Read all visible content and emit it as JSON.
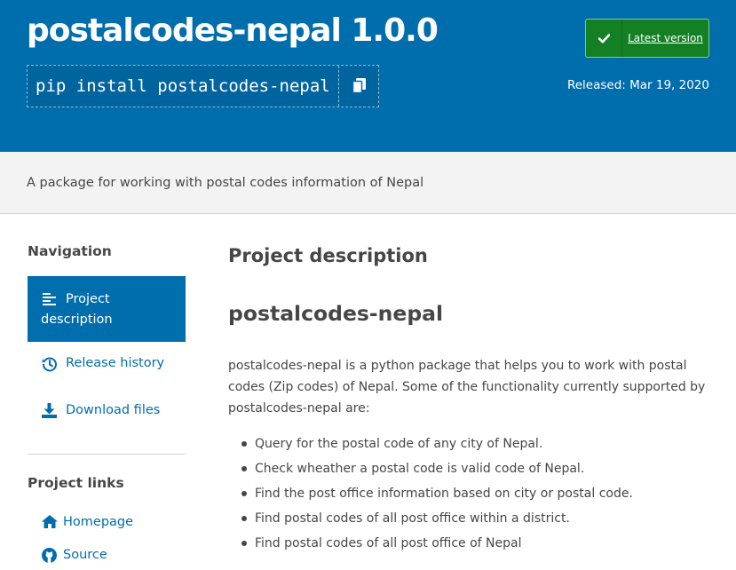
{
  "header": {
    "package_title": "postalcodes-nepal 1.0.0",
    "pip_command": "pip install postalcodes-nepal",
    "latest_version_label": "Latest version",
    "released_label": "Released: Mar 19, 2020"
  },
  "summary": "A package for working with postal codes information of Nepal",
  "sidebar": {
    "navigation_heading": "Navigation",
    "nav_items": [
      {
        "label": "Project description",
        "icon": "align-left-icon",
        "active": true
      },
      {
        "label": "Release history",
        "icon": "history-icon",
        "active": false
      },
      {
        "label": "Download files",
        "icon": "download-icon",
        "active": false
      }
    ],
    "links_heading": "Project links",
    "links": [
      {
        "label": "Homepage",
        "icon": "home-icon"
      },
      {
        "label": "Source",
        "icon": "github-icon"
      }
    ]
  },
  "main": {
    "section_heading": "Project description",
    "readme_title": "postalcodes-nepal",
    "readme_paragraph": "postalcodes-nepal is a python package that helps you to work with postal codes (Zip codes) of Nepal. Some of the functionality currently supported by postalcodes-nepal are:",
    "bullets": [
      "Query for the postal code of any city of Nepal.",
      "Check wheather a postal code is valid code of Nepal.",
      "Find the post office information based on city or postal code.",
      "Find postal codes of all post office within a district.",
      "Find postal codes of all post office of Nepal"
    ]
  },
  "colors": {
    "header_blue": "#006dad",
    "latest_green": "#148024",
    "summary_band": "#f3f3f3",
    "text": "#464646"
  }
}
